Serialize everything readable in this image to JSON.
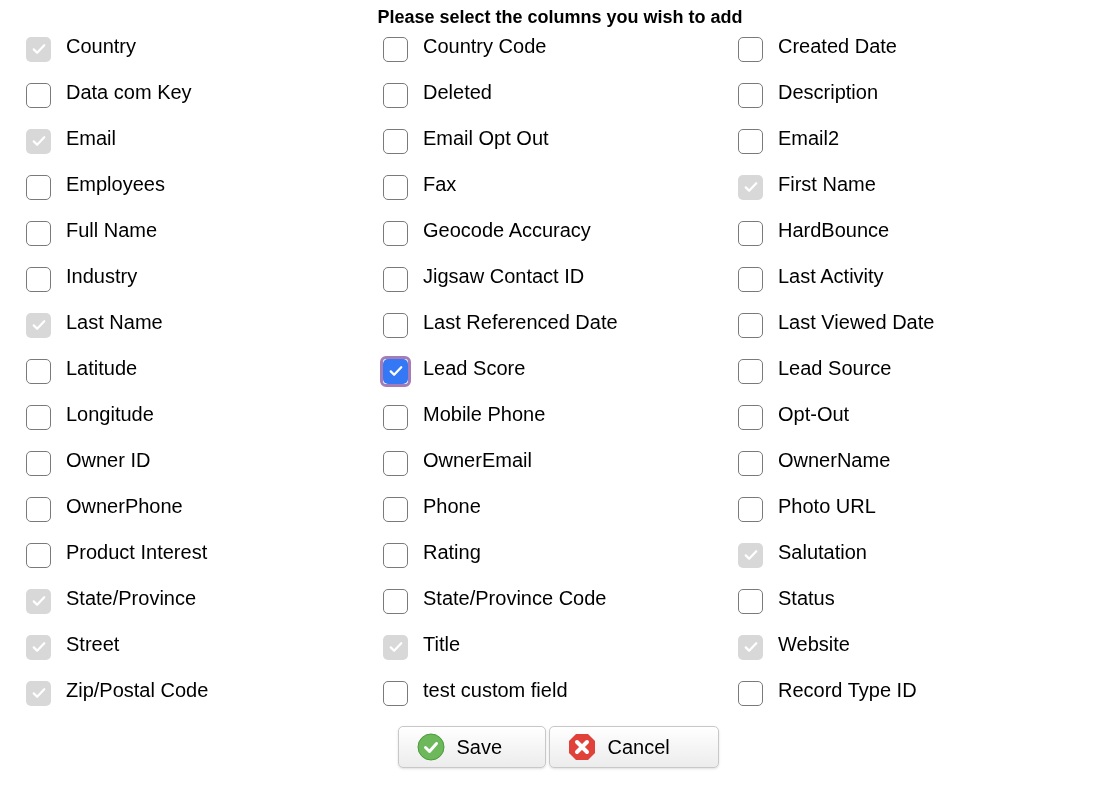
{
  "title": "Please select the columns you wish to add",
  "columns": [
    {
      "label": "Country",
      "checked": true,
      "disabled": true,
      "focused": false
    },
    {
      "label": "Country Code",
      "checked": false,
      "disabled": false,
      "focused": false
    },
    {
      "label": "Created Date",
      "checked": false,
      "disabled": false,
      "focused": false
    },
    {
      "label": "Data com Key",
      "checked": false,
      "disabled": false,
      "focused": false
    },
    {
      "label": "Deleted",
      "checked": false,
      "disabled": false,
      "focused": false
    },
    {
      "label": "Description",
      "checked": false,
      "disabled": false,
      "focused": false
    },
    {
      "label": "Email",
      "checked": true,
      "disabled": true,
      "focused": false
    },
    {
      "label": "Email Opt Out",
      "checked": false,
      "disabled": false,
      "focused": false
    },
    {
      "label": "Email2",
      "checked": false,
      "disabled": false,
      "focused": false
    },
    {
      "label": "Employees",
      "checked": false,
      "disabled": false,
      "focused": false
    },
    {
      "label": "Fax",
      "checked": false,
      "disabled": false,
      "focused": false
    },
    {
      "label": "First Name",
      "checked": true,
      "disabled": true,
      "focused": false
    },
    {
      "label": "Full Name",
      "checked": false,
      "disabled": false,
      "focused": false
    },
    {
      "label": "Geocode Accuracy",
      "checked": false,
      "disabled": false,
      "focused": false
    },
    {
      "label": "HardBounce",
      "checked": false,
      "disabled": false,
      "focused": false
    },
    {
      "label": "Industry",
      "checked": false,
      "disabled": false,
      "focused": false
    },
    {
      "label": "Jigsaw Contact ID",
      "checked": false,
      "disabled": false,
      "focused": false
    },
    {
      "label": "Last Activity",
      "checked": false,
      "disabled": false,
      "focused": false
    },
    {
      "label": "Last Name",
      "checked": true,
      "disabled": true,
      "focused": false
    },
    {
      "label": "Last Referenced Date",
      "checked": false,
      "disabled": false,
      "focused": false
    },
    {
      "label": "Last Viewed Date",
      "checked": false,
      "disabled": false,
      "focused": false
    },
    {
      "label": "Latitude",
      "checked": false,
      "disabled": false,
      "focused": false
    },
    {
      "label": "Lead Score",
      "checked": true,
      "disabled": false,
      "focused": true
    },
    {
      "label": "Lead Source",
      "checked": false,
      "disabled": false,
      "focused": false
    },
    {
      "label": "Longitude",
      "checked": false,
      "disabled": false,
      "focused": false
    },
    {
      "label": "Mobile Phone",
      "checked": false,
      "disabled": false,
      "focused": false
    },
    {
      "label": "Opt-Out",
      "checked": false,
      "disabled": false,
      "focused": false
    },
    {
      "label": "Owner ID",
      "checked": false,
      "disabled": false,
      "focused": false
    },
    {
      "label": "OwnerEmail",
      "checked": false,
      "disabled": false,
      "focused": false
    },
    {
      "label": "OwnerName",
      "checked": false,
      "disabled": false,
      "focused": false
    },
    {
      "label": "OwnerPhone",
      "checked": false,
      "disabled": false,
      "focused": false
    },
    {
      "label": "Phone",
      "checked": false,
      "disabled": false,
      "focused": false
    },
    {
      "label": "Photo URL",
      "checked": false,
      "disabled": false,
      "focused": false
    },
    {
      "label": "Product Interest",
      "checked": false,
      "disabled": false,
      "focused": false
    },
    {
      "label": "Rating",
      "checked": false,
      "disabled": false,
      "focused": false
    },
    {
      "label": "Salutation",
      "checked": true,
      "disabled": true,
      "focused": false
    },
    {
      "label": "State/Province",
      "checked": true,
      "disabled": true,
      "focused": false
    },
    {
      "label": "State/Province Code",
      "checked": false,
      "disabled": false,
      "focused": false
    },
    {
      "label": "Status",
      "checked": false,
      "disabled": false,
      "focused": false
    },
    {
      "label": "Street",
      "checked": true,
      "disabled": true,
      "focused": false
    },
    {
      "label": "Title",
      "checked": true,
      "disabled": true,
      "focused": false
    },
    {
      "label": "Website",
      "checked": true,
      "disabled": true,
      "focused": false
    },
    {
      "label": "Zip/Postal Code",
      "checked": true,
      "disabled": true,
      "focused": false
    },
    {
      "label": "test custom field",
      "checked": false,
      "disabled": false,
      "focused": false
    },
    {
      "label": "Record Type ID",
      "checked": false,
      "disabled": false,
      "focused": false
    }
  ],
  "buttons": [
    {
      "kind": "save",
      "label": "Save"
    },
    {
      "kind": "cancel",
      "label": "Cancel"
    }
  ]
}
